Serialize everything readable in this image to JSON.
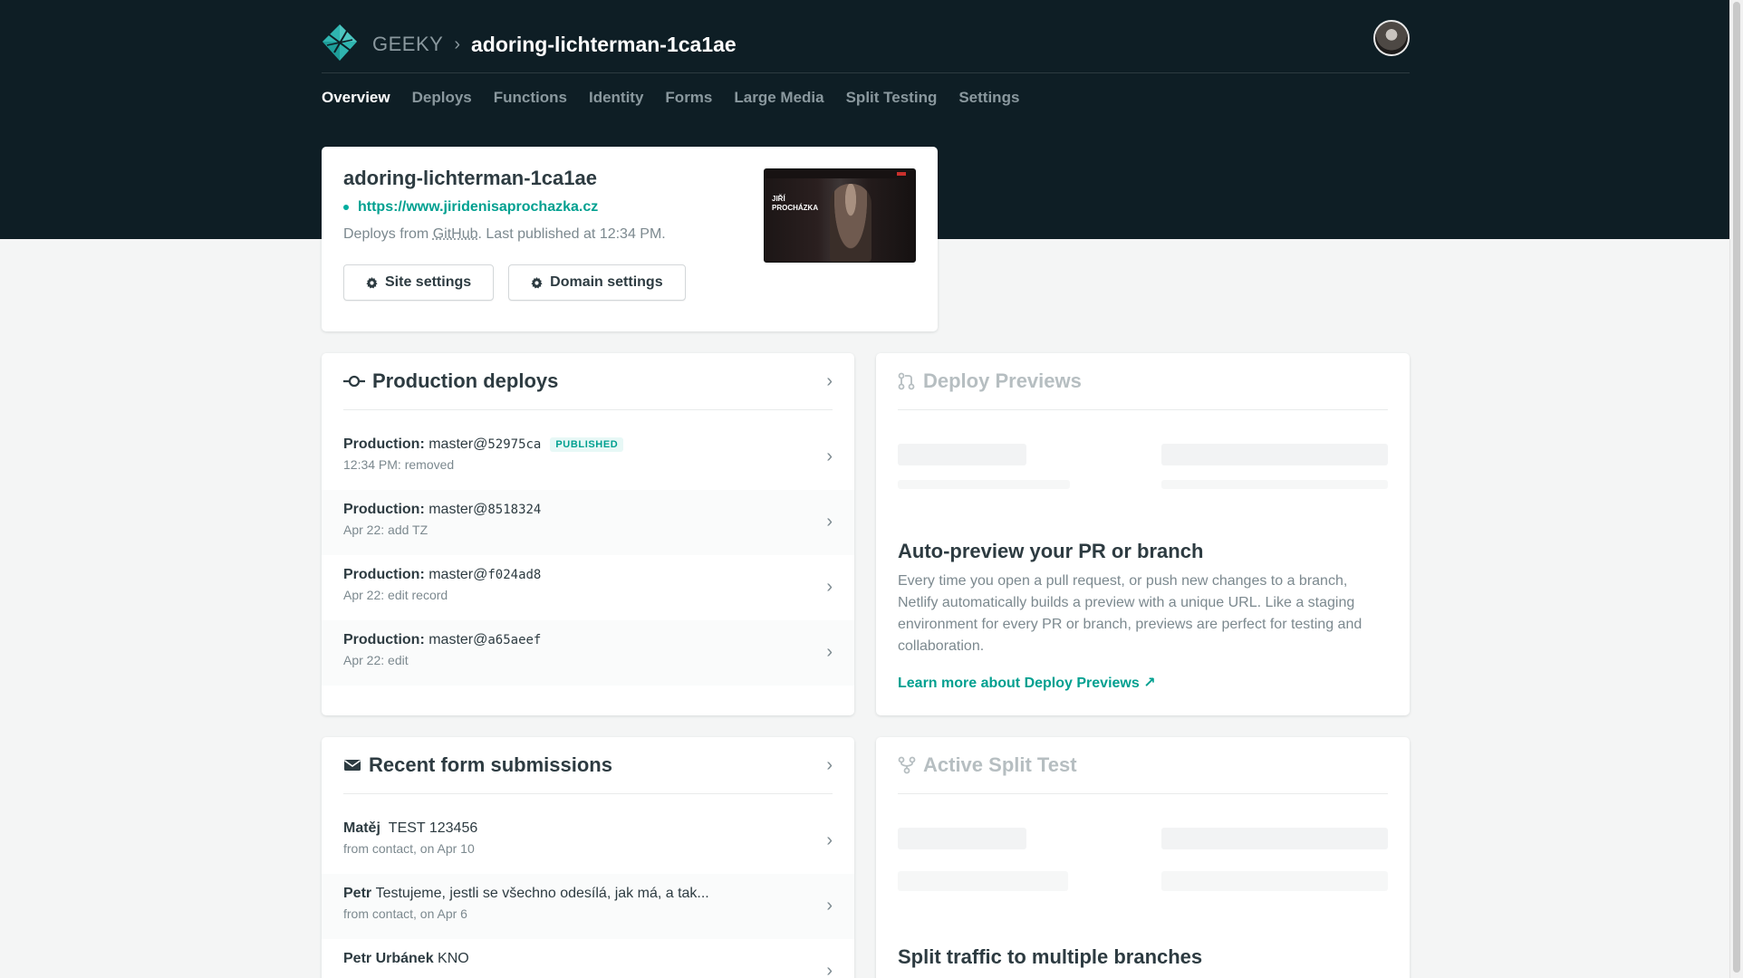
{
  "header": {
    "team": "GEEKY",
    "separator": "›",
    "site_name": "adoring-lichterman-1ca1ae"
  },
  "nav": {
    "items": [
      "Overview",
      "Deploys",
      "Functions",
      "Identity",
      "Forms",
      "Large Media",
      "Split Testing",
      "Settings"
    ],
    "active": "Overview"
  },
  "site_card": {
    "title": "adoring-lichterman-1ca1ae",
    "url": "https://www.jiridenisaprochazka.cz",
    "deploy_prefix": "Deploys from ",
    "deploy_source": "GitHub",
    "deploy_suffix": ". Last published at 12:34 PM.",
    "site_settings_label": "Site settings",
    "domain_settings_label": "Domain settings",
    "thumb_text_1": "JIŘÍ",
    "thumb_text_2": "PROCHÁZKA"
  },
  "production": {
    "title": "Production deploys",
    "rows": [
      {
        "label": "Production:",
        "ref": "master@",
        "hash": "52975ca",
        "badge": "PUBLISHED",
        "sub": "12:34 PM: removed"
      },
      {
        "label": "Production:",
        "ref": "master@",
        "hash": "8518324",
        "badge": "",
        "sub": "Apr 22: add TZ"
      },
      {
        "label": "Production:",
        "ref": "master@",
        "hash": "f024ad8",
        "badge": "",
        "sub": "Apr 22: edit record"
      },
      {
        "label": "Production:",
        "ref": "master@",
        "hash": "a65aeef",
        "badge": "",
        "sub": "Apr 22: edit"
      }
    ]
  },
  "previews": {
    "title": "Deploy Previews",
    "promo_title": "Auto-preview your PR or branch",
    "promo_text": "Every time you open a pull request, or push new changes to a branch, Netlify automatically builds a preview with a unique URL. Like a staging environment for every PR or branch, previews are perfect for testing and collaboration.",
    "link": "Learn more about Deploy Previews ↗"
  },
  "forms": {
    "title": "Recent form submissions",
    "rows": [
      {
        "name": "Matěj",
        "text": "TEST 123456",
        "sub": "from contact, on Apr 10"
      },
      {
        "name": "Petr",
        "text": "Testujeme, jestli se všechno odesílá, jak má, a tak...",
        "sub": "from contact, on Apr 6"
      },
      {
        "name": "Petr Urbánek",
        "text": "KNO",
        "sub": ""
      }
    ]
  },
  "split": {
    "title": "Active Split Test",
    "promo_title": "Split traffic to multiple branches"
  },
  "colors": {
    "header_bg": "#0e1e25",
    "accent": "#00a090",
    "text": "#2d3b41",
    "muted": "#7c898f"
  }
}
